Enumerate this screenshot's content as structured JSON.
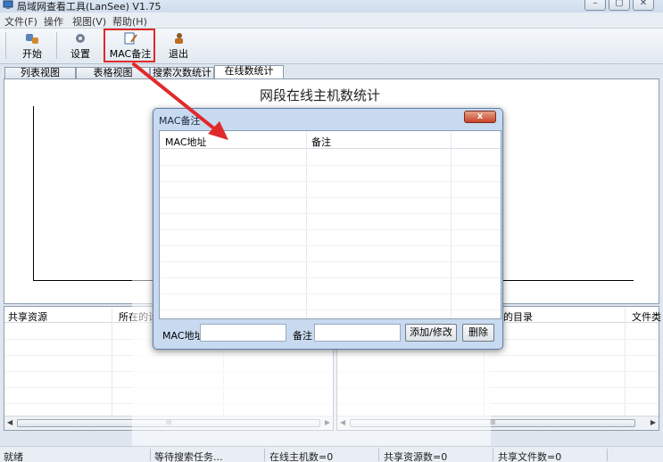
{
  "window": {
    "title": "局域网查看工具(LanSee) V1.75",
    "controls": [
      "–",
      "▢",
      "✕"
    ]
  },
  "menubar": {
    "items": [
      "文件(F)",
      "操作",
      "视图(V)",
      "帮助(H)"
    ]
  },
  "toolbar": {
    "items": [
      {
        "label": "开始",
        "icon": "start-icon"
      },
      {
        "label": "设置",
        "icon": "settings-icon"
      },
      {
        "label": "MAC备注",
        "icon": "mac-note-icon"
      },
      {
        "label": "退出",
        "icon": "exit-icon"
      }
    ]
  },
  "tabs": [
    {
      "label": "列表视图",
      "active": false
    },
    {
      "label": "表格视图",
      "active": false
    },
    {
      "label": "搜索次数统计",
      "active": false
    },
    {
      "label": "在线数统计",
      "active": true
    }
  ],
  "chart": {
    "title": "网段在线主机数统计"
  },
  "lower_left": {
    "columns": [
      "共享资源",
      "所在的计"
    ]
  },
  "lower_right": {
    "columns": [
      "的目录",
      "文件类"
    ]
  },
  "scrollbar": {
    "thumb": "III",
    "left": "◀",
    "right": "▶"
  },
  "statusbar": {
    "ready": "就绪",
    "task": "等待搜索任务...",
    "online_hosts": "在线主机数=0",
    "shared_resources": "共享资源数=0",
    "shared_files": "共享文件数=0"
  },
  "dialog": {
    "title": "MAC备注",
    "close": "x",
    "columns": [
      "MAC地址",
      "备注"
    ],
    "mac_label": "MAC地址",
    "mac_value": "",
    "note_label": "备注",
    "note_value": "",
    "add_button": "添加/修改",
    "delete_button": "删除"
  },
  "colors": {
    "annotation": "#e02a2a",
    "dialog_frame": "#c8daf0",
    "close_button": "#c8442a"
  }
}
